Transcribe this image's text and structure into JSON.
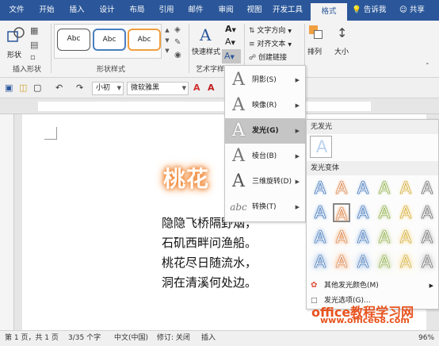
{
  "tabs": [
    {
      "label": "文件",
      "active": false
    },
    {
      "label": "开始",
      "active": false
    },
    {
      "label": "插入",
      "active": false
    },
    {
      "label": "设计",
      "active": false
    },
    {
      "label": "布局",
      "active": false
    },
    {
      "label": "引用",
      "active": false
    },
    {
      "label": "邮件",
      "active": false
    },
    {
      "label": "审阅",
      "active": false
    },
    {
      "label": "视图",
      "active": false
    },
    {
      "label": "开发工具",
      "active": false
    },
    {
      "label": "格式",
      "active": true
    }
  ],
  "tab_right": {
    "tell_me": "告诉我",
    "share": "共享"
  },
  "ribbon": {
    "insert_shape_group": "插入形状",
    "shape_label": "形状",
    "shape_styles_group": "形状样式",
    "style_boxes": [
      "Abc",
      "Abc",
      "Abc"
    ],
    "quick_styles": "快速样式",
    "art_text_group": "艺术字样",
    "text_direction": "文字方向",
    "align_text": "对齐文本",
    "create_link": "创建链接",
    "arrange": "排列",
    "size": "大小"
  },
  "format_bar": {
    "font_size": "小初",
    "font_name": "微软雅黑"
  },
  "effects_menu": {
    "items": [
      {
        "label": "阴影(S)",
        "highlighted": false
      },
      {
        "label": "映像(R)",
        "highlighted": false
      },
      {
        "label": "发光(G)",
        "highlighted": true
      },
      {
        "label": "棱台(B)",
        "highlighted": false
      },
      {
        "label": "三维旋转(D)",
        "highlighted": false
      },
      {
        "label": "转换(T)",
        "highlighted": false
      }
    ]
  },
  "glow_menu": {
    "no_glow": "无发光",
    "variants": "发光变体",
    "more_colors": "其他发光颜色(M)",
    "options": "发光选项(G)..."
  },
  "document": {
    "art_title": "桃花",
    "lines": [
      "隐隐飞桥隔野烟，",
      "石矶西畔问渔船。",
      "桃花尽日随流水，",
      "洞在清溪何处边。"
    ]
  },
  "status": {
    "page": "第 1 页，共 1 页",
    "words": "3/35 个字",
    "lang": "中文(中国)",
    "track": "修订: 关闭",
    "insert": "插入",
    "zoom": "96%"
  },
  "watermark": {
    "line1": "office教程学习网",
    "line2": "www.office68.com"
  },
  "colors": {
    "tabbar": "#2b579a",
    "glow_orange": "#f08a3a",
    "watermark": "#e8531e"
  }
}
